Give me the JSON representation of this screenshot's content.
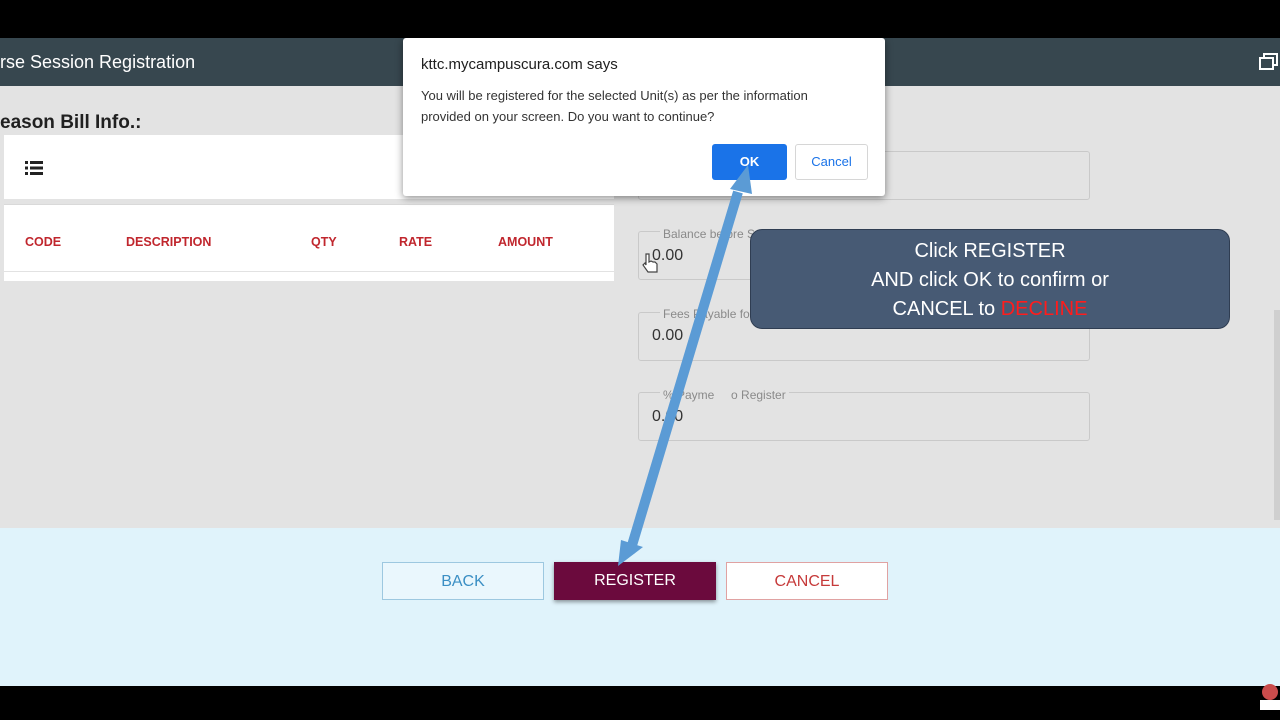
{
  "header": {
    "title": "rse Session Registration"
  },
  "section": {
    "title": "eason Bill Info.:"
  },
  "table": {
    "columns": [
      "CODE",
      "DESCRIPTION",
      "QTY",
      "RATE",
      "AMOUNT"
    ]
  },
  "fields": [
    {
      "label": "Balance before S",
      "value": "0.00"
    },
    {
      "label": "Fees Payable fo",
      "value": "0.00"
    },
    {
      "label": "% Payme     o Register",
      "value": "0.00"
    }
  ],
  "footer": {
    "back": "BACK",
    "register": "REGISTER",
    "cancel": "CANCEL"
  },
  "dialog": {
    "title": "kttc.mycampuscura.com says",
    "message": "You will be registered for the selected Unit(s) as per the information provided on your screen. Do you want to continue?",
    "ok": "OK",
    "cancel": "Cancel"
  },
  "callout": {
    "line1": "Click  REGISTER",
    "line2": "AND click OK to confirm or",
    "line3_prefix": "CANCEL to ",
    "line3_highlight": "DECLINE"
  },
  "colors": {
    "header": "#37474f",
    "register": "#6b0a3d",
    "table_header": "#c0262d",
    "arrow": "#5b9bd5",
    "callout": "#475a74"
  }
}
